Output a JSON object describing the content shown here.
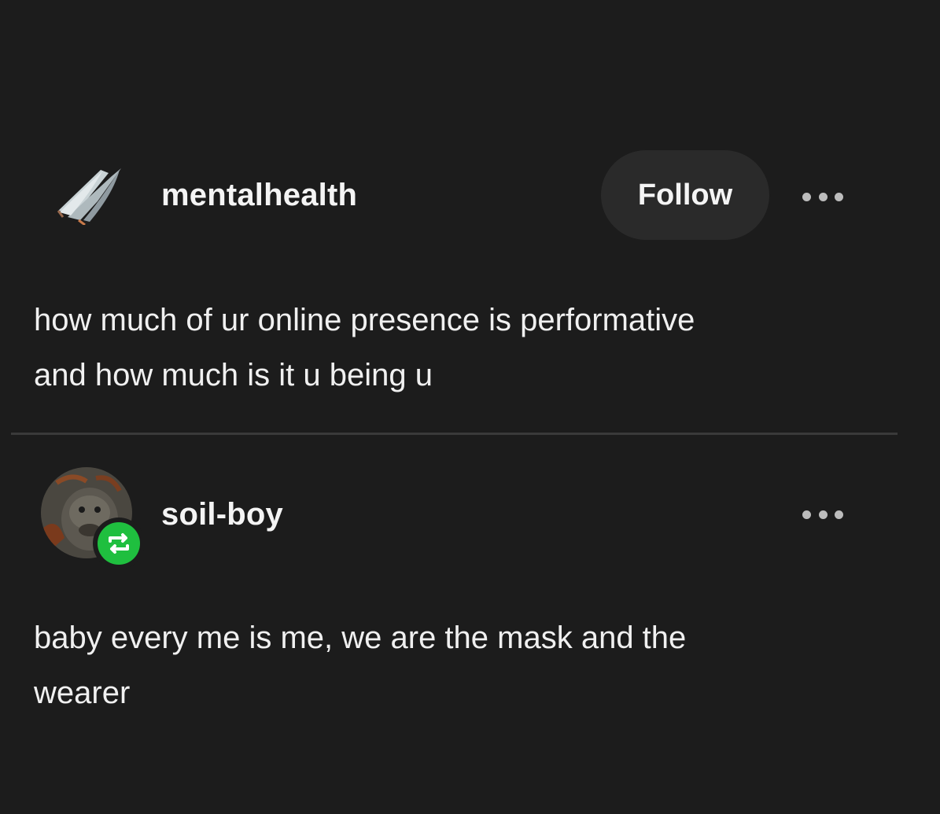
{
  "posts": [
    {
      "username": "mentalhealth",
      "avatar_icon": "butterfly-icon",
      "follow_label": "Follow",
      "more_icon": "ellipsis-icon",
      "text_lines": [
        "how much of ur online presence is performative",
        "and how much is it u being u"
      ]
    },
    {
      "username": "soil-boy",
      "avatar_icon": "orangutan-avatar",
      "badge_icon": "reblog-icon",
      "badge_color": "#1fbf3f",
      "more_icon": "ellipsis-icon",
      "text_lines": [
        "baby every me is me, we are the mask and the",
        "wearer"
      ]
    }
  ],
  "colors": {
    "background": "#1c1c1c",
    "button_bg": "#2a2a2a",
    "text": "#f0f0f0",
    "divider": "#3a3a3a"
  }
}
